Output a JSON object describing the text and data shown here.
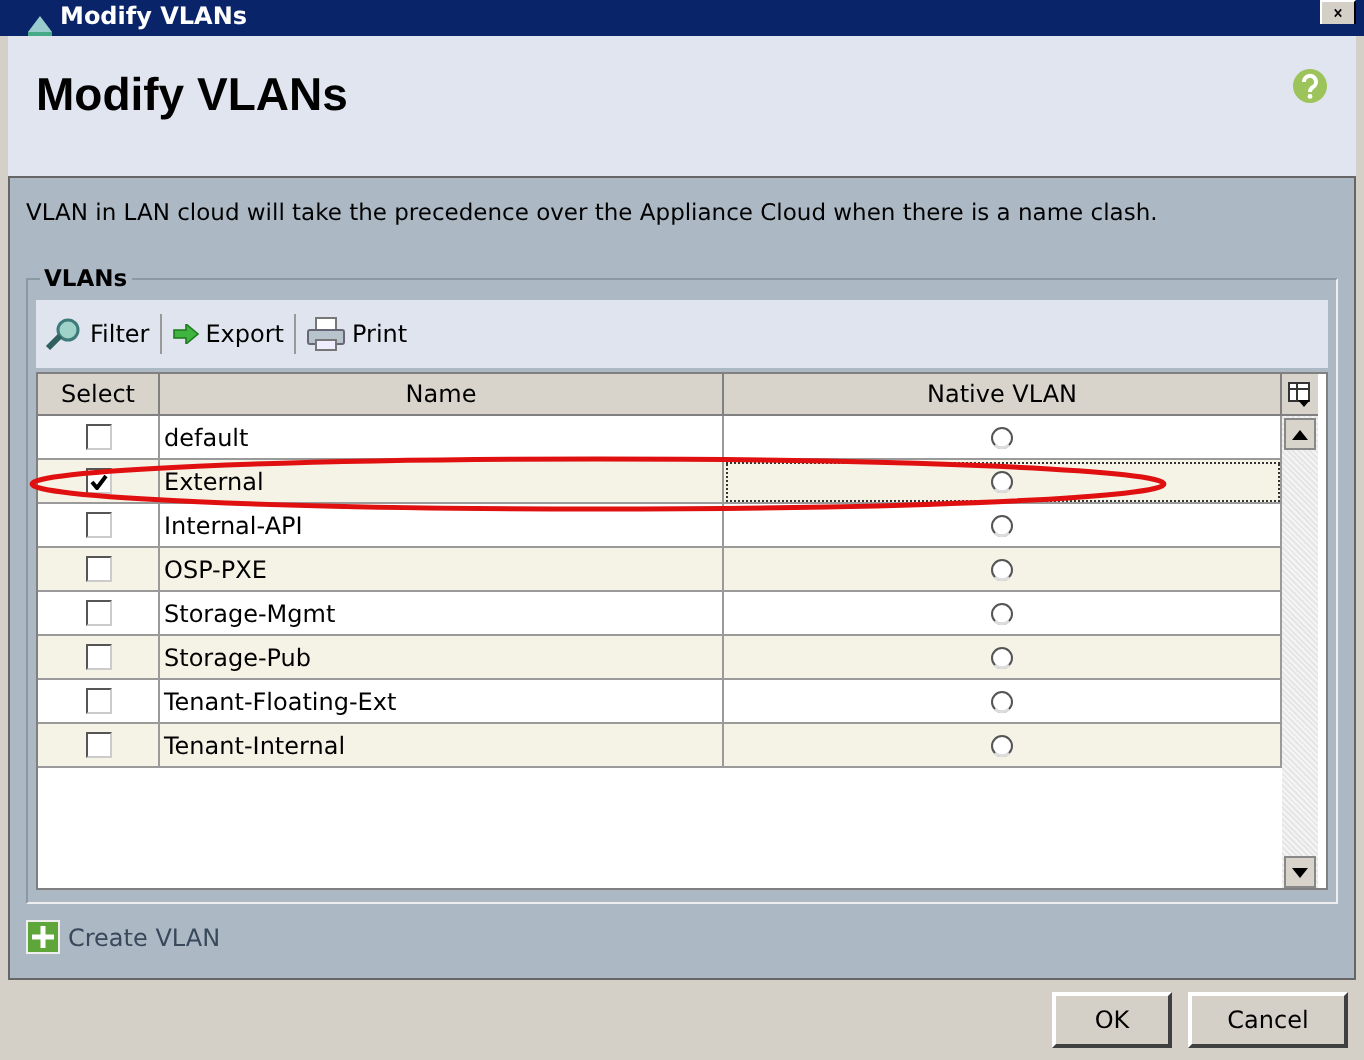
{
  "window": {
    "title": "Modify VLANs"
  },
  "header": {
    "title": "Modify VLANs"
  },
  "info": "VLAN in LAN cloud will take the precedence over the Appliance Cloud when there is a name clash.",
  "group": {
    "legend": "VLANs",
    "toolbar": [
      {
        "kind": "filter",
        "label": "Filter"
      },
      {
        "kind": "export",
        "label": "Export"
      },
      {
        "kind": "print",
        "label": "Print"
      }
    ]
  },
  "table": {
    "columns": [
      "Select",
      "Name",
      "Native VLAN"
    ],
    "rows": [
      {
        "name": "default",
        "checked": false,
        "native": false,
        "selected": false
      },
      {
        "name": "External",
        "checked": true,
        "native": false,
        "selected": true
      },
      {
        "name": "Internal-API",
        "checked": false,
        "native": false,
        "selected": false
      },
      {
        "name": "OSP-PXE",
        "checked": false,
        "native": false,
        "selected": false
      },
      {
        "name": "Storage-Mgmt",
        "checked": false,
        "native": false,
        "selected": false
      },
      {
        "name": "Storage-Pub",
        "checked": false,
        "native": false,
        "selected": false
      },
      {
        "name": "Tenant-Floating-Ext",
        "checked": false,
        "native": false,
        "selected": false
      },
      {
        "name": "Tenant-Internal",
        "checked": false,
        "native": false,
        "selected": false
      }
    ]
  },
  "create_link": "Create VLAN",
  "buttons": [
    "OK",
    "Cancel"
  ]
}
